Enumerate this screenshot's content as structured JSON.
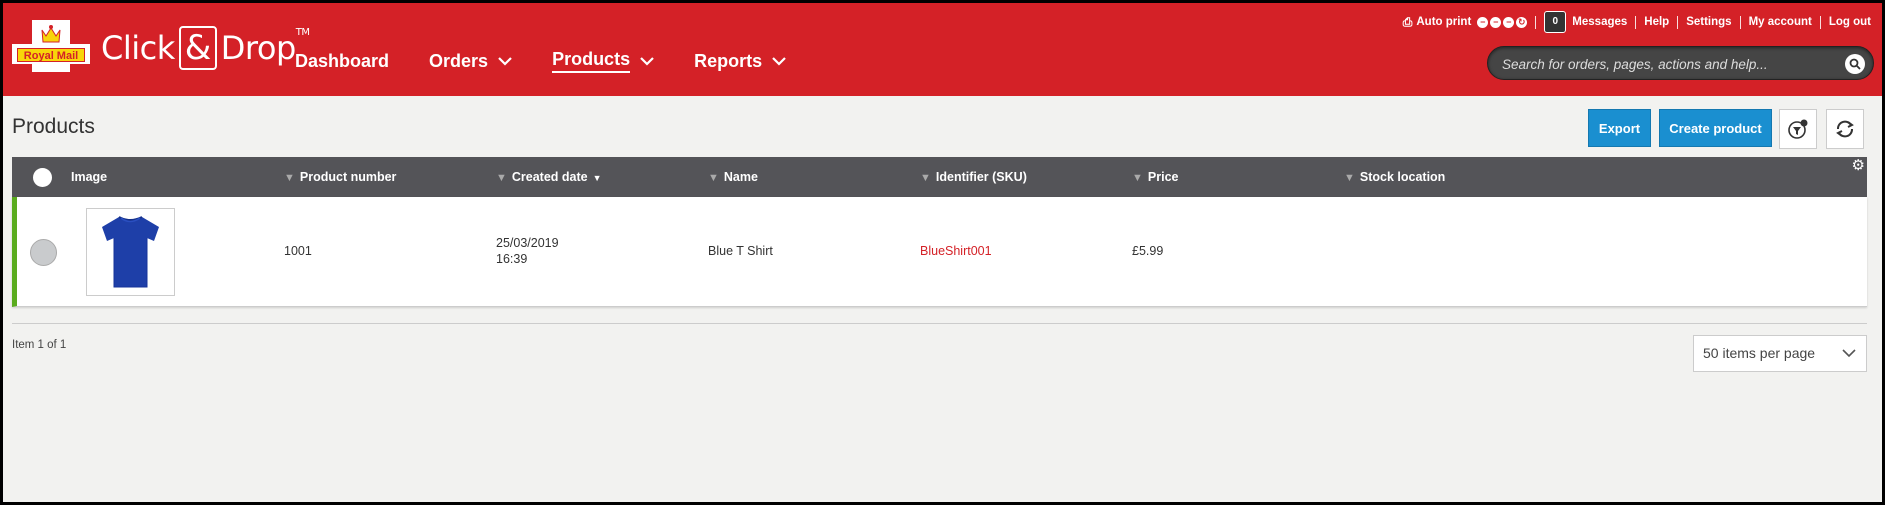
{
  "header": {
    "brand_left": "Click",
    "brand_amp": "&",
    "brand_right": "Drop",
    "brand_tm": "TM",
    "logo_text": "Royal Mail",
    "nav": [
      {
        "label": "Dashboard",
        "dropdown": false
      },
      {
        "label": "Orders",
        "dropdown": true
      },
      {
        "label": "Products",
        "dropdown": true,
        "active": true
      },
      {
        "label": "Reports",
        "dropdown": true
      }
    ],
    "util": {
      "auto_print": "Auto print",
      "message_count": "0",
      "messages": "Messages",
      "help": "Help",
      "settings": "Settings",
      "my_account": "My account",
      "log_out": "Log out"
    },
    "search_placeholder": "Search for orders, pages, actions and help..."
  },
  "page": {
    "title": "Products",
    "export_label": "Export",
    "create_label": "Create product"
  },
  "table": {
    "columns": [
      "Image",
      "Product number",
      "Created date",
      "Name",
      "Identifier (SKU)",
      "Price",
      "Stock location"
    ],
    "rows": [
      {
        "image": "blue-tshirt",
        "product_number": "1001",
        "created_date": "25/03/2019",
        "created_time": "16:39",
        "name": "Blue T Shirt",
        "sku": "BlueShirt001",
        "price": "£5.99",
        "stock_location": ""
      }
    ]
  },
  "pager": {
    "summary": "Item 1 of 1",
    "per_page": "50 items per page"
  },
  "colors": {
    "brand_red": "#d42127",
    "primary_button": "#1a8fd0",
    "table_header": "#545458",
    "row_accent": "#5aab1e",
    "sku_link": "#d42127"
  }
}
